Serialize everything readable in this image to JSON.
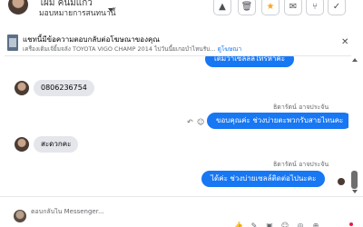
{
  "header": {
    "contact_name": "ไผ่ม คนมีแกว",
    "assignment_label": "มอบหมายการสนทนานี้",
    "toolbar": [
      {
        "name": "alert-button",
        "glyph": "▲"
      },
      {
        "name": "delete-button",
        "glyph": "🗑"
      },
      {
        "name": "star-button",
        "glyph": "★"
      },
      {
        "name": "mail-button",
        "glyph": "✉"
      },
      {
        "name": "label-button",
        "glyph": "⑂"
      },
      {
        "name": "done-button",
        "glyph": "✓"
      }
    ]
  },
  "banner": {
    "title": "แชทนี้มีข้อความตอบกลับต่อโฆษณาของคุณ",
    "subtitle": "เครื่องเดิมเจ้ยิ้มจลัง TOYOTA VIGO CHAMP 2014 ไปวันนี้ยเกอบำไหนรับ...",
    "link": "ดูโฆษณา",
    "close": "✕"
  },
  "messages": {
    "top_partial": "เต็มวาเซลล์ล์ไทรหาคะ",
    "phone": "0806236754",
    "sender_1": "ธิดารัตน์ อาจประจัน",
    "reply_1": "ขอบคุณค่ะ ช่วงบ่ายตะพวกรับสายไหนคะ",
    "thanks": "สะดวกคะ",
    "sender_2": "ธิดารัตน์ อาจประจัน",
    "reply_2": "ได้ค่ะ ช่วงบ่ายเซลล์ติดต่อไปนะคะ"
  },
  "composer": {
    "placeholder": "ตอบกลับใน Messenger...",
    "tools": [
      {
        "name": "thumbs-up-icon",
        "glyph": "👍"
      },
      {
        "name": "attachment-icon",
        "glyph": "✎"
      },
      {
        "name": "gif-icon",
        "glyph": "▣"
      },
      {
        "name": "emoji-icon",
        "glyph": "☺"
      },
      {
        "name": "camera-icon",
        "glyph": "◎"
      },
      {
        "name": "more-icon",
        "glyph": "⊕"
      }
    ]
  }
}
